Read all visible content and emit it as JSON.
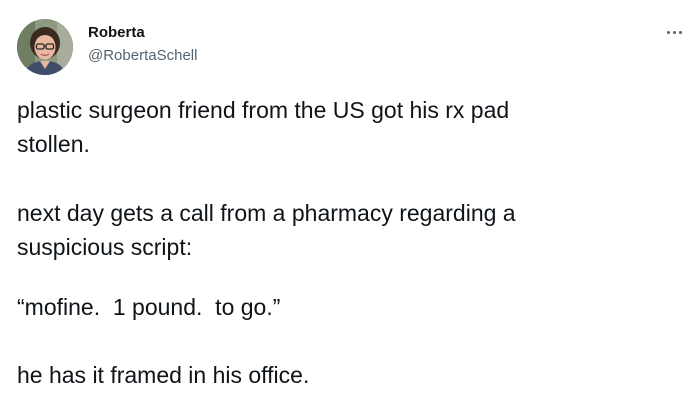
{
  "tweet": {
    "author": {
      "display_name": "Roberta",
      "handle": "@RobertaSchell",
      "avatar_icon": "profile-photo"
    },
    "more_icon": "more-horizontal-icon",
    "lines": [
      "plastic surgeon friend from the US got his rx pad",
      "stollen.",
      "next day gets a call from a pharmacy regarding a",
      "suspicious script:",
      "“mofine.  1 pound.  to go.”",
      "he has it framed in his office."
    ]
  },
  "colors": {
    "text": "#0f1419",
    "secondary_text": "#536471",
    "background": "#ffffff"
  }
}
